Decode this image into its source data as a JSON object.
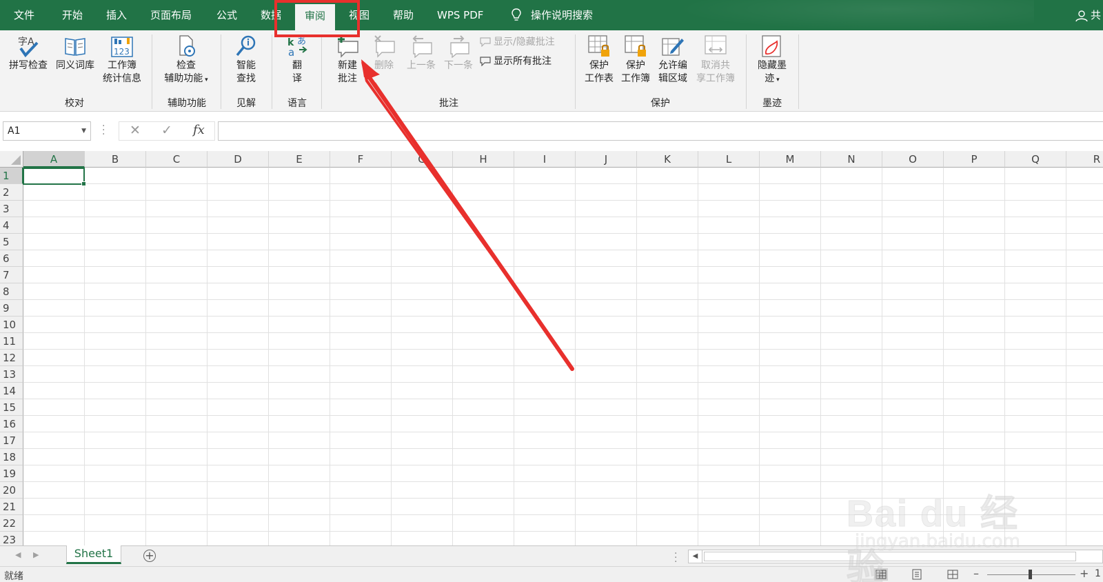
{
  "menu": {
    "items": [
      "文件",
      "开始",
      "插入",
      "页面布局",
      "公式",
      "数据",
      "审阅",
      "视图",
      "帮助",
      "WPS PDF"
    ],
    "active": "审阅",
    "search": "操作说明搜索",
    "share": "共"
  },
  "ribbon": {
    "proofing": {
      "spell": "拼写检查",
      "thesaurus": "同义词库",
      "stats_1": "工作簿",
      "stats_2": "统计信息",
      "label": "校对"
    },
    "accessibility": {
      "check_1": "检查",
      "check_2": "辅助功能",
      "label": "辅助功能"
    },
    "insights": {
      "smart_1": "智能",
      "smart_2": "查找",
      "label": "见解"
    },
    "language": {
      "translate_1": "翻",
      "translate_2": "译",
      "label": "语言"
    },
    "comments": {
      "new_1": "新建",
      "new_2": "批注",
      "delete": "删除",
      "prev": "上一条",
      "next": "下一条",
      "show_hide": "显示/隐藏批注",
      "show_all": "显示所有批注",
      "label": "批注"
    },
    "protect": {
      "sheet_1": "保护",
      "sheet_2": "工作表",
      "book_1": "保护",
      "book_2": "工作簿",
      "ranges_1": "允许编",
      "ranges_2": "辑区域",
      "unshare_1": "取消共",
      "unshare_2": "享工作簿",
      "label": "保护"
    },
    "ink": {
      "hide_1": "隐藏墨",
      "hide_2": "迹",
      "label": "墨迹"
    }
  },
  "formula_bar": {
    "name_box": "A1",
    "fx": "fx",
    "formula": ""
  },
  "grid": {
    "columns": [
      "A",
      "B",
      "C",
      "D",
      "E",
      "F",
      "G",
      "H",
      "I",
      "J",
      "K",
      "L",
      "M",
      "N",
      "O",
      "P",
      "Q",
      "R"
    ],
    "rows": [
      "1",
      "2",
      "3",
      "4",
      "5",
      "6",
      "7",
      "8",
      "9",
      "10",
      "11",
      "12",
      "13",
      "14",
      "15",
      "16",
      "17",
      "18",
      "19",
      "20",
      "21",
      "22",
      "23"
    ],
    "active_cell": "A1"
  },
  "sheets": {
    "tabs": [
      "Sheet1"
    ],
    "active": "Sheet1"
  },
  "status": {
    "text": "就绪",
    "zoom": "1"
  },
  "watermark": {
    "logo": "Bai du 经验",
    "url": "jingyan.baidu.com"
  },
  "colors": {
    "accent": "#217346",
    "annotation": "#e8302d"
  }
}
